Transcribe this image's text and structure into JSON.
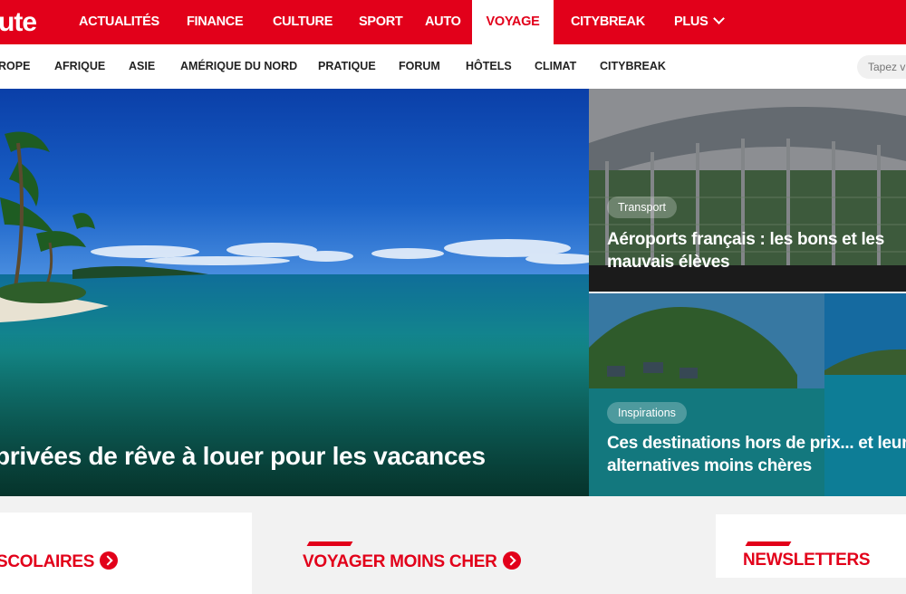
{
  "header": {
    "logo": "ute",
    "nav": [
      {
        "label": "ACTUALITÉS"
      },
      {
        "label": "FINANCE"
      },
      {
        "label": "CULTURE"
      },
      {
        "label": "SPORT"
      },
      {
        "label": "AUTO"
      },
      {
        "label": "VOYAGE",
        "active": true
      },
      {
        "label": "CITYBREAK"
      },
      {
        "label": "PLUS"
      }
    ]
  },
  "subnav": {
    "items": [
      "ROPE",
      "AFRIQUE",
      "ASIE",
      "AMÉRIQUE DU NORD",
      "PRATIQUE",
      "FORUM",
      "HÔTELS",
      "CLIMAT",
      "CITYBREAK"
    ],
    "search_placeholder": "Tapez v"
  },
  "hero": {
    "title": "privées de rêve à louer pour les vacances"
  },
  "cards": [
    {
      "tag": "Transport",
      "title": "Aéroports français : les bons et les mauvais élèves"
    },
    {
      "tag": "Inspirations",
      "title": "Ces destinations hors de prix... et leurs alternatives moins chères"
    }
  ],
  "sections": {
    "left": "SCOLAIRES",
    "middle": "VOYAGER MOINS CHER",
    "right": "NEWSLETTERS"
  },
  "colors": {
    "brand": "#e2001a"
  }
}
